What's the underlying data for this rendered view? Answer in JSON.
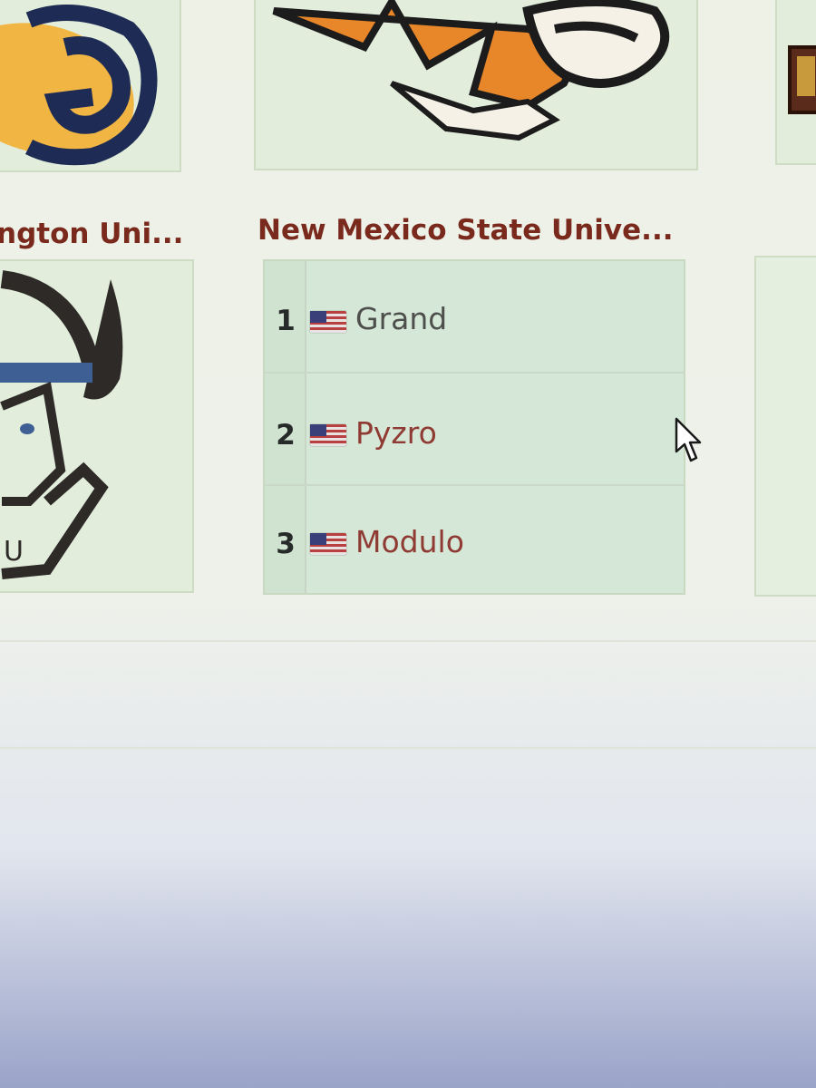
{
  "teams": {
    "left": {
      "title": "ngton Uni..."
    },
    "center": {
      "title": "New Mexico State Unive..."
    }
  },
  "leaderboard": {
    "rows": [
      {
        "rank": "1",
        "player": "Grand"
      },
      {
        "rank": "2",
        "player": "Pyzro"
      },
      {
        "rank": "3",
        "player": "Modulo"
      }
    ]
  },
  "colors": {
    "title": "#7a2a1c",
    "player_link": "#8f3a33",
    "player_visited": "#4e4f4d",
    "card_bg": "#dcebd2"
  },
  "icons": {
    "flag": "us-flag-icon",
    "cursor": "mouse-pointer-icon"
  }
}
